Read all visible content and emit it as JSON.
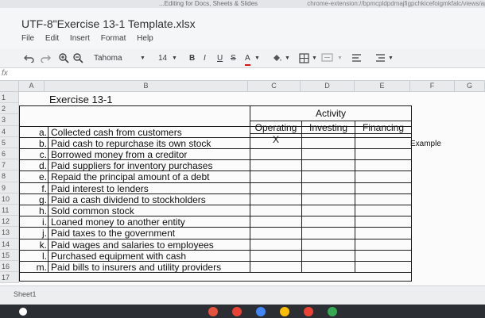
{
  "browser": {
    "tab_text": "...Editing for Docs, Sheets & Slides",
    "url": "chrome-extension://bpmcpldpdmajfigpchkicefoigmkfalc/views/app.html"
  },
  "document": {
    "title": "UTF-8\"Exercise 13-1 Template.xlsx"
  },
  "menu": [
    "File",
    "Edit",
    "Insert",
    "Format",
    "Help"
  ],
  "toolbar": {
    "font_name": "Tahoma",
    "font_size": "14",
    "bold": "B",
    "italic": "I",
    "underline": "U",
    "strike": "S",
    "text_color": "A"
  },
  "formula_bar": {
    "fx": "fx"
  },
  "columns": [
    "A",
    "B",
    "C",
    "D",
    "E",
    "F",
    "G"
  ],
  "rows": [
    "1",
    "2",
    "3",
    "4",
    "5",
    "6",
    "7",
    "8",
    "9",
    "10",
    "11",
    "12",
    "13",
    "14",
    "15",
    "16",
    "17"
  ],
  "sheet": {
    "title": "Exercise 13-1",
    "activity_header": "Activity",
    "headers": [
      "Operating",
      "Investing",
      "Financing"
    ],
    "example_mark": "X",
    "example_label": "Example",
    "items": [
      {
        "letter": "a.",
        "text": "Collected cash from customers"
      },
      {
        "letter": "b.",
        "text": "Paid cash to repurchase its own stock"
      },
      {
        "letter": "c.",
        "text": "Borrowed money from a creditor"
      },
      {
        "letter": "d.",
        "text": "Paid suppliers for inventory purchases"
      },
      {
        "letter": "e.",
        "text": "Repaid the principal amount of a debt"
      },
      {
        "letter": "f.",
        "text": "Paid interest to lenders"
      },
      {
        "letter": "g.",
        "text": "Paid a cash dividend to stockholders"
      },
      {
        "letter": "h.",
        "text": "Sold common stock"
      },
      {
        "letter": "i.",
        "text": "Loaned money to another entity"
      },
      {
        "letter": "j.",
        "text": "Paid taxes to the government"
      },
      {
        "letter": "k.",
        "text": "Paid wages and salaries to employees"
      },
      {
        "letter": "l.",
        "text": "Purchased equipment with cash"
      },
      {
        "letter": "m.",
        "text": "Paid bills to insurers and utility providers"
      }
    ]
  },
  "sheet_tab": "Sheet1"
}
